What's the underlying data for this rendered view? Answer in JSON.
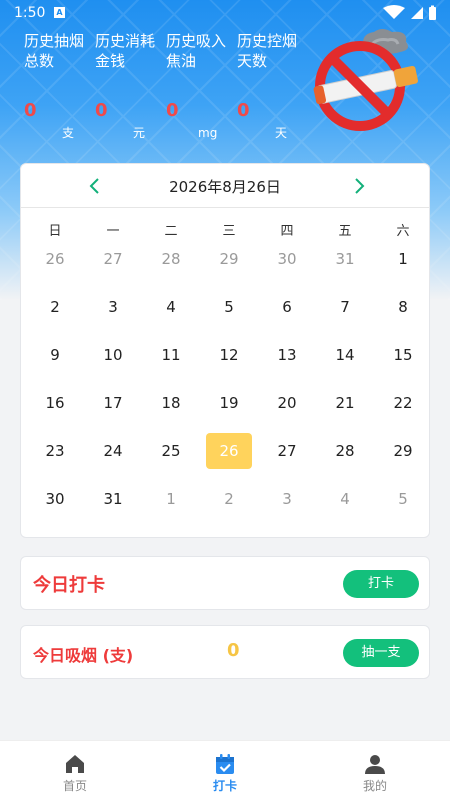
{
  "status_bar": {
    "time": "1:50",
    "sim_glyph": "A"
  },
  "colors": {
    "accent": "#2a8cf0",
    "stat_value": "#f04a4a",
    "selected_day": "#ffd35c",
    "button": "#13c07c",
    "count": "#f6c545"
  },
  "stats": [
    {
      "label": "历史抽烟总数",
      "value": "0",
      "unit": "支"
    },
    {
      "label": "历史消耗金钱",
      "value": "0",
      "unit": "元"
    },
    {
      "label": "历史吸入焦油",
      "value": "0",
      "unit": "mg"
    },
    {
      "label": "历史控烟天数",
      "value": "0",
      "unit": "天"
    }
  ],
  "hero_icon": "no-smoking-icon",
  "calendar": {
    "title": "2026年8月26日",
    "prev_icon": "chevron-left-icon",
    "next_icon": "chevron-right-icon",
    "weekdays": [
      "日",
      "一",
      "二",
      "三",
      "四",
      "五",
      "六"
    ],
    "weeks": [
      [
        "26",
        "27",
        "28",
        "29",
        "30",
        "31",
        "1"
      ],
      [
        "2",
        "3",
        "4",
        "5",
        "6",
        "7",
        "8"
      ],
      [
        "9",
        "10",
        "11",
        "12",
        "13",
        "14",
        "15"
      ],
      [
        "16",
        "17",
        "18",
        "19",
        "20",
        "21",
        "22"
      ],
      [
        "23",
        "24",
        "25",
        "26",
        "27",
        "28",
        "29"
      ],
      [
        "30",
        "31",
        "1",
        "2",
        "3",
        "4",
        "5"
      ]
    ],
    "muted": [
      [
        0,
        0
      ],
      [
        0,
        1
      ],
      [
        0,
        2
      ],
      [
        0,
        3
      ],
      [
        0,
        4
      ],
      [
        0,
        5
      ],
      [
        5,
        2
      ],
      [
        5,
        3
      ],
      [
        5,
        4
      ],
      [
        5,
        5
      ],
      [
        5,
        6
      ]
    ],
    "selected": [
      4,
      3
    ]
  },
  "checkin": {
    "title": "今日打卡",
    "button": "打卡"
  },
  "smoke": {
    "title": "今日吸烟 (支)",
    "count": "0",
    "button": "抽一支"
  },
  "tabs": [
    {
      "label": "首页",
      "icon": "home-icon",
      "active": false
    },
    {
      "label": "打卡",
      "icon": "calendar-check-icon",
      "active": true
    },
    {
      "label": "我的",
      "icon": "user-icon",
      "active": false
    }
  ]
}
